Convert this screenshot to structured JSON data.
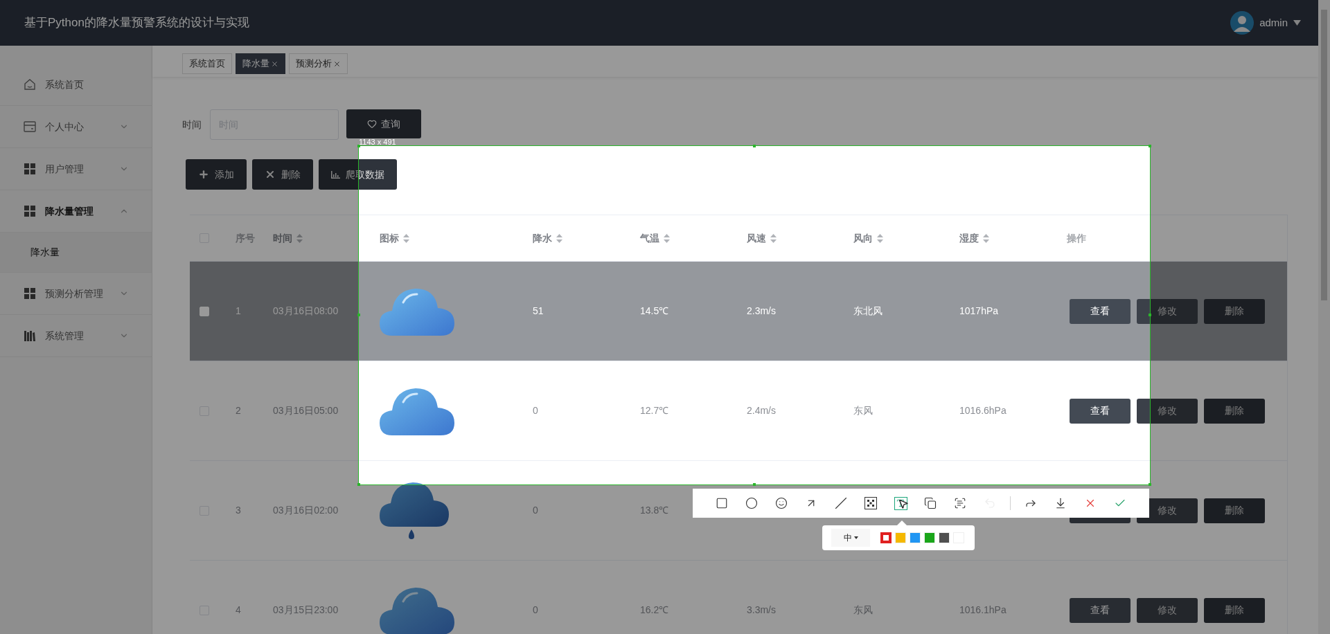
{
  "header": {
    "title": "基于Python的降水量预警系统的设计与实现",
    "user": "admin"
  },
  "sidebar": {
    "items": [
      {
        "label": "系统首页",
        "kind": "home"
      },
      {
        "label": "个人中心",
        "kind": "card",
        "expanded": false
      },
      {
        "label": "用户管理",
        "kind": "grid",
        "expanded": false
      },
      {
        "label": "降水量管理",
        "kind": "grid",
        "expanded": true,
        "children": [
          {
            "label": "降水量",
            "selected": true
          }
        ]
      },
      {
        "label": "预测分析管理",
        "kind": "grid",
        "expanded": false
      },
      {
        "label": "系统管理",
        "kind": "books",
        "expanded": false
      }
    ]
  },
  "tabs": [
    {
      "label": "系统首页",
      "selected": false,
      "closable": false
    },
    {
      "label": "降水量",
      "selected": true,
      "closable": true
    },
    {
      "label": "预测分析",
      "selected": false,
      "closable": true
    }
  ],
  "search": {
    "label": "时间",
    "placeholder": "时间",
    "button": "查询"
  },
  "actions": [
    {
      "label": "添加",
      "kind": "plus"
    },
    {
      "label": "删除",
      "kind": "x"
    },
    {
      "label": "爬取数据",
      "kind": "chart"
    }
  ],
  "table": {
    "header_checked": false,
    "columns": [
      {
        "label": "序号",
        "sortable": false
      },
      {
        "label": "时间",
        "sortable": true
      },
      {
        "label": "图标",
        "sortable": true
      },
      {
        "label": "降水",
        "sortable": true
      },
      {
        "label": "气温",
        "sortable": true
      },
      {
        "label": "风速",
        "sortable": true
      },
      {
        "label": "风向",
        "sortable": true
      },
      {
        "label": "湿度",
        "sortable": true
      },
      {
        "label": "操作",
        "sortable": false
      }
    ],
    "rows": [
      {
        "checked": false,
        "highlighted": true,
        "cells": [
          "1",
          "03月16日08:00",
          {
            "kind": "cloud"
          },
          "51",
          "14.5℃",
          "2.3m/s",
          "东北风",
          "1017hPa"
        ],
        "buttons": [
          {
            "kind": "view",
            "label": "查看"
          },
          {
            "kind": "edit",
            "label": "修改"
          },
          {
            "kind": "delete",
            "label": "删除"
          }
        ]
      },
      {
        "checked": false,
        "highlighted": false,
        "cells": [
          "2",
          "03月16日05:00",
          {
            "kind": "cloud"
          },
          "0",
          "12.7℃",
          "2.4m/s",
          "东风",
          "1016.6hPa"
        ],
        "buttons": [
          {
            "kind": "view",
            "label": "查看"
          },
          {
            "kind": "edit",
            "label": "修改"
          },
          {
            "kind": "delete",
            "label": "删除"
          }
        ]
      },
      {
        "checked": false,
        "highlighted": false,
        "cells": [
          "3",
          "03月16日02:00",
          {
            "kind": "rain"
          },
          "0",
          "13.8℃"
        ],
        "buttons": [
          {
            "kind": "view"
          },
          {
            "kind": "edit",
            "label": "修改"
          },
          {
            "kind": "delete",
            "label": "删除"
          }
        ]
      },
      {
        "checked": false,
        "highlighted": false,
        "cells": [
          "4",
          "03月15日23:00",
          {
            "kind": "cloud"
          },
          "0",
          "16.2℃",
          "3.3m/s",
          "东风",
          "1016.1hPa"
        ],
        "buttons": [
          {
            "kind": "view",
            "label": "查看"
          },
          {
            "kind": "edit",
            "label": "修改"
          },
          {
            "kind": "delete",
            "label": "删除"
          }
        ]
      }
    ]
  },
  "capture": {
    "size": "1143 x 491",
    "tools": [
      {
        "kind": "rect",
        "selected": false,
        "disabled": false
      },
      {
        "kind": "ellipse",
        "selected": false,
        "disabled": false
      },
      {
        "kind": "emoji",
        "selected": false,
        "disabled": false
      },
      {
        "kind": "arrow",
        "selected": false,
        "disabled": false
      },
      {
        "kind": "pen",
        "selected": false,
        "disabled": false
      },
      {
        "kind": "mosaic",
        "selected": false,
        "disabled": false
      },
      {
        "kind": "text",
        "selected": true,
        "disabled": false
      },
      {
        "kind": "copy",
        "selected": false,
        "disabled": false
      },
      {
        "kind": "ocr",
        "selected": false,
        "disabled": false
      },
      {
        "kind": "undo",
        "selected": false,
        "disabled": true
      },
      {
        "kind": "separator"
      },
      {
        "kind": "share",
        "selected": false,
        "disabled": false
      },
      {
        "kind": "save",
        "selected": false,
        "disabled": false
      },
      {
        "kind": "cancel",
        "selected": false,
        "disabled": false
      },
      {
        "kind": "done",
        "selected": false,
        "disabled": false
      }
    ],
    "pen_size": "中",
    "swatches": [
      {
        "color": "#e02020",
        "selected": true
      },
      {
        "color": "#f5b800",
        "selected": false
      },
      {
        "color": "#2196f3",
        "selected": false
      },
      {
        "color": "#1aa61a",
        "selected": false
      },
      {
        "color": "#505050",
        "selected": false
      },
      {
        "color": "#ffffff",
        "selected": false
      }
    ]
  }
}
